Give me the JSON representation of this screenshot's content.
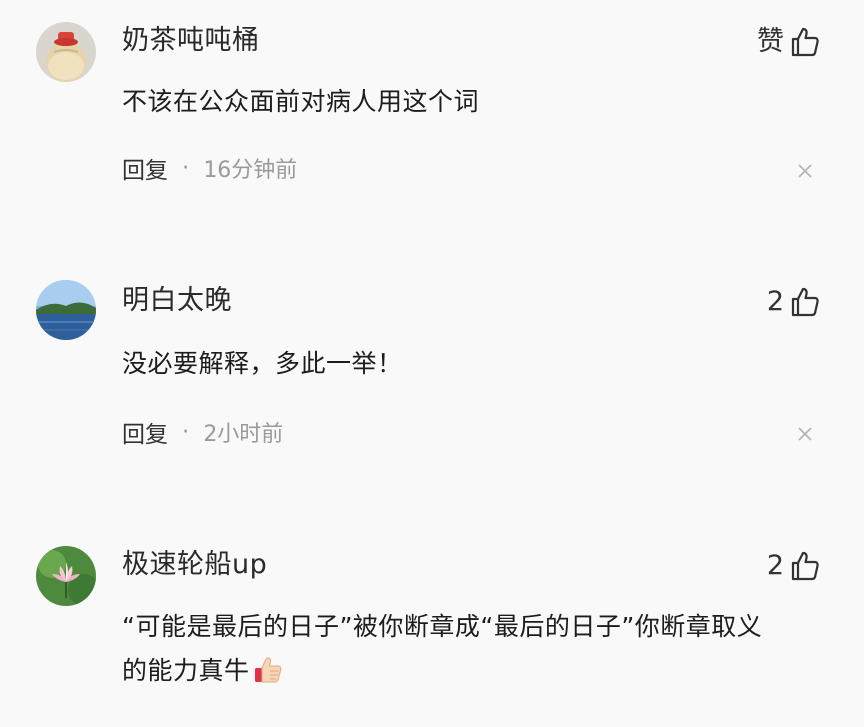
{
  "comments": [
    {
      "username": "奶茶吨吨桶",
      "like_label": "赞",
      "text": "不该在公众面前对病人用这个词",
      "reply_label": "回复",
      "dot": "·",
      "time": "16分钟前",
      "avatar": "milk-tea-cup-avatar"
    },
    {
      "username": "明白太晚",
      "like_label": "2",
      "text": "没必要解释，多此一举！",
      "reply_label": "回复",
      "dot": "·",
      "time": "2小时前",
      "avatar": "lake-landscape-avatar"
    },
    {
      "username": "极速轮船up",
      "like_label": "2",
      "text_line1": "“可能是最后的日子”被你断章成“最后的日子”你断章取义",
      "text_line2": "的能力真牛",
      "avatar": "lotus-flower-avatar",
      "emoji": "thumbs-up-emoji"
    }
  ],
  "colors": {
    "background": "#f9f9f9",
    "text": "#1c1c1c",
    "meta": "#9a9a9a"
  }
}
